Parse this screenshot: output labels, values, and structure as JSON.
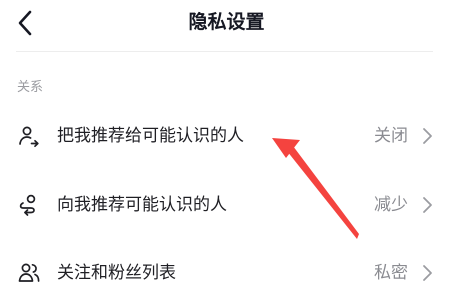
{
  "header": {
    "title": "隐私设置",
    "back_icon": "chevron-left-icon"
  },
  "section": {
    "label": "关系"
  },
  "rows": [
    {
      "icon": "user-share-icon",
      "label": "把我推荐给可能认识的人",
      "value": "关闭"
    },
    {
      "icon": "user-route-icon",
      "label": "向我推荐可能认识的人",
      "value": "减少"
    },
    {
      "icon": "users-icon",
      "label": "关注和粉丝列表",
      "value": "私密"
    }
  ],
  "colors": {
    "annotation_arrow": "#f4433f",
    "text_primary": "#1f1f24",
    "text_secondary": "#8a8b91"
  }
}
